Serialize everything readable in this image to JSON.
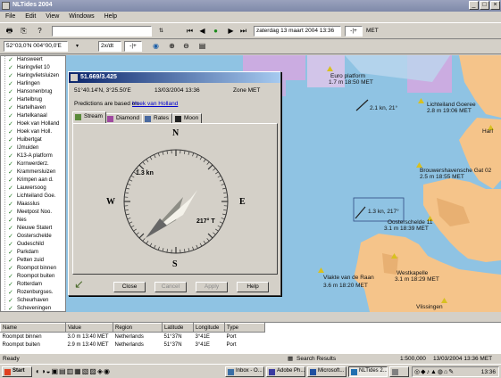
{
  "window": {
    "title": "NLTides 2004"
  },
  "menu": [
    "File",
    "Edit",
    "View",
    "Windows",
    "Help"
  ],
  "toolbar": {
    "date_value": "zaterdag 13 maart 2004 13:36",
    "timezone": "MET",
    "position_value": "52°03,0'N 004°00,0'E",
    "interval_value": "2x/dt"
  },
  "sidebar": {
    "items": [
      "Hansweert",
      "Haringvliet 10",
      "Haringvlietsluizen",
      "Harlingen",
      "Hansonenbrug",
      "Hartelbrug",
      "Hartelhaven",
      "Hartelkanaal",
      "Hoek van Holland",
      "Hoek van Holl.",
      "Huibertgat",
      "IJmuiden",
      "K13-A platform",
      "Kornwerderz.",
      "Krammersluizen",
      "Krimpen aan d.",
      "Lauwersoog",
      "Lichteiland Goe.",
      "Maasslus",
      "Meetpost Noo.",
      "Nes",
      "Nieuwe Statert",
      "Oosterschelde",
      "Oudeschild",
      "Parkdam",
      "Petten zuid",
      "Roompot binnen",
      "Roompot buiten",
      "Rotterdam",
      "Rozenburgses.",
      "Scheurhaven",
      "Scheveningen",
      "Schiermonnikoog"
    ]
  },
  "dialog": {
    "title": "51.669/3.425",
    "position": "51°40.14'N, 3°25.50'E",
    "date": "13/03/2004 13:36",
    "zone": "Zone MET",
    "prediction_label": "Predictions are based on",
    "prediction_link": "Hoek van Holland",
    "tabs": [
      "Stream",
      "Diamond",
      "Rates",
      "Moon"
    ],
    "compass": {
      "n": "N",
      "e": "E",
      "s": "S",
      "w": "W"
    },
    "speed": "1.3 kn",
    "bearing": "217° T",
    "buttons": {
      "close": "Close",
      "cancel": "Cancel",
      "apply": "Apply",
      "help": "Help"
    }
  },
  "map": {
    "labels": [
      "Euro platform",
      "1.7 m 18:50 MET",
      "2.1 kn, 21°",
      "Lichteiland Goeree",
      "2.8 m 19:06 MET",
      "Haringvlietsluizen 10",
      "Brouwershavensche Gat 02",
      "2.5 m 18:55 MET",
      "1.3 kn, 217°",
      "Oosterschelde 11",
      "3.1 m 18:39 MET",
      "Westkapelle",
      "Vlakte van de Raan",
      "3.6 m 18:20 MET",
      "3.1 m 18:29 MET",
      "Vlissingen",
      "Harl"
    ]
  },
  "grid": {
    "headers": [
      "Name",
      "Value",
      "Region",
      "Latitude",
      "Longitude",
      "Type"
    ],
    "rows": [
      [
        "Roompot binnen",
        "3.0 m 13:40 MET",
        "Netherlands",
        "51°37N",
        "3°41E",
        "Port"
      ],
      [
        "Roompot buiten",
        "2.9 m 13:40 MET",
        "Netherlands",
        "51°37N",
        "3°41E",
        "Port"
      ],
      [
        "",
        "",
        "",
        "",
        "",
        ""
      ]
    ]
  },
  "status": {
    "left": "Ready",
    "search": "Search Results",
    "scale": "1:500,000",
    "datetime": "13/03/2004 13:36 MET"
  },
  "taskbar": {
    "start": "Start",
    "buttons": [
      "Inbox - O...",
      "Adobe Ph...",
      "Microsoft...",
      "NLTides 2...",
      ""
    ],
    "clock": "13:36"
  },
  "colors": {
    "sea": "#8fc3e3",
    "land": "#f5c48a",
    "zone": "#d6a8e0",
    "title": "#0a246a"
  }
}
